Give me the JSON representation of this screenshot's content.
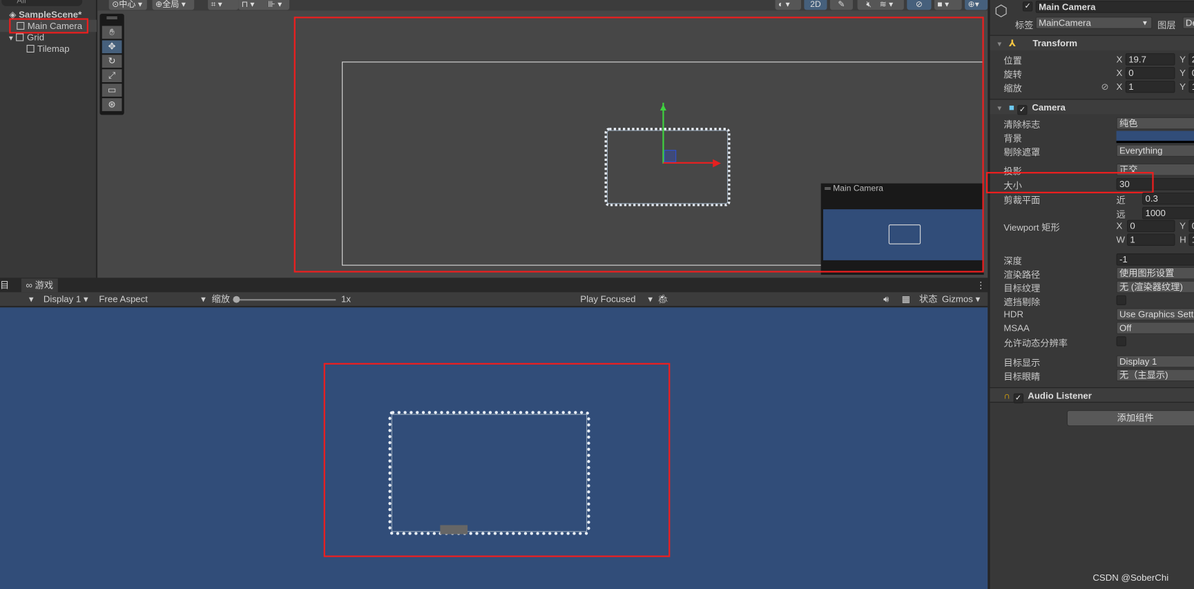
{
  "hierarchy": {
    "search_placeholder": "All",
    "scene": "SampleScene*",
    "items": [
      "Main Camera",
      "Grid",
      "Tilemap"
    ]
  },
  "scene_toolbar": {
    "pivot": "中心",
    "space": "全局",
    "mode_2d": "2D"
  },
  "tools": [
    "hand",
    "move",
    "rotate",
    "scale",
    "rect",
    "transform"
  ],
  "camera_preview": {
    "title": "Main Camera"
  },
  "game": {
    "tab_left": "目",
    "tab": "游戏",
    "display": "Display 1",
    "aspect": "Free Aspect",
    "scale_label": "缩放",
    "scale_value": "1x",
    "play_mode": "Play Focused",
    "stats": "状态",
    "gizmos": "Gizmos"
  },
  "inspector": {
    "name": "Main Camera",
    "tag_label": "标签",
    "tag": "MainCamera",
    "layer_label": "图层",
    "layer": "De",
    "transform": {
      "title": "Transform",
      "rows": [
        {
          "label": "位置",
          "x": "19.7",
          "y": "2"
        },
        {
          "label": "旋转",
          "x": "0",
          "y": "0"
        },
        {
          "label": "缩放",
          "x": "1",
          "y": "1"
        }
      ]
    },
    "camera": {
      "title": "Camera",
      "clear_flags_label": "清除标志",
      "clear_flags": "纯色",
      "background_label": "背景",
      "background_color": "#314d79",
      "culling_label": "剔除遮罩",
      "culling": "Everything",
      "projection_label": "投影",
      "projection": "正交",
      "size_label": "大小",
      "size": "30",
      "clip_label": "剪裁平面",
      "near_label": "近",
      "near": "0.3",
      "far_label": "远",
      "far": "1000",
      "viewport_label": "Viewport 矩形",
      "vx": "0",
      "vy": "0",
      "vw": "1",
      "vh": "1",
      "depth_label": "深度",
      "depth": "-1",
      "render_path_label": "渲染路径",
      "render_path": "使用图形设置",
      "target_texture_label": "目标纹理",
      "target_texture": "无 (渲染器纹理)",
      "occlusion_label": "遮挡剔除",
      "hdr_label": "HDR",
      "hdr": "Use Graphics Settings",
      "msaa_label": "MSAA",
      "msaa": "Off",
      "dynres_label": "允许动态分辨率",
      "target_display_label": "目标显示",
      "target_display": "Display 1",
      "target_eye_label": "目标眼睛",
      "target_eye": "无（主显示)"
    },
    "audio": {
      "title": "Audio Listener"
    },
    "add_component": "添加组件"
  },
  "watermark": "CSDN @SoberChi",
  "colors": {
    "highlight": "#f01e1e",
    "game_bg": "#314d79"
  }
}
